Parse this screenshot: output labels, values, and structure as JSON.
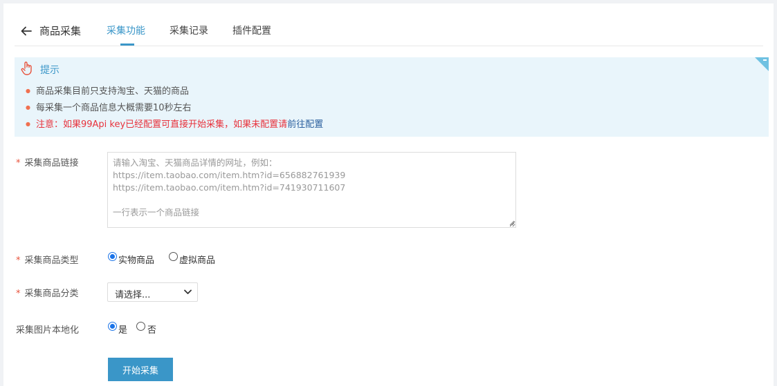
{
  "header": {
    "title": "商品采集",
    "tabs": [
      {
        "label": "采集功能"
      },
      {
        "label": "采集记录"
      },
      {
        "label": "插件配置"
      }
    ]
  },
  "tip": {
    "title": "提示",
    "lines": [
      "商品采集目前只支持淘宝、天猫的商品",
      "每采集一个商品信息大概需要10秒左右",
      "注意：如果99Api key已经配置可直接开始采集，如果未配置请"
    ],
    "link_text": "前往配置"
  },
  "form": {
    "url_label": "采集商品链接",
    "url_placeholder": "请输入淘宝、天猫商品详情的网址，例如：\nhttps://item.taobao.com/item.htm?id=656882761939\nhttps://item.taobao.com/item.htm?id=741930711607\n\n一行表示一个商品链接",
    "type_label": "采集商品类型",
    "type_options": [
      {
        "label": "实物商品",
        "checked": true
      },
      {
        "label": "虚拟商品",
        "checked": false
      }
    ],
    "category_label": "采集商品分类",
    "category_value": "请选择...",
    "localize_label": "采集图片本地化",
    "localize_options": [
      {
        "label": "是",
        "checked": true
      },
      {
        "label": "否",
        "checked": false
      }
    ],
    "required_mark": "*",
    "submit_label": "开始采集"
  },
  "colors": {
    "accent": "#3a96c8",
    "tip_background": "#e9f5fb",
    "warning_text": "#e8323c",
    "required_star": "#e8533c"
  },
  "icons": {
    "back": "arrow-left-icon",
    "tip": "hand-pointer-icon",
    "select": "chevron-down-icon"
  }
}
